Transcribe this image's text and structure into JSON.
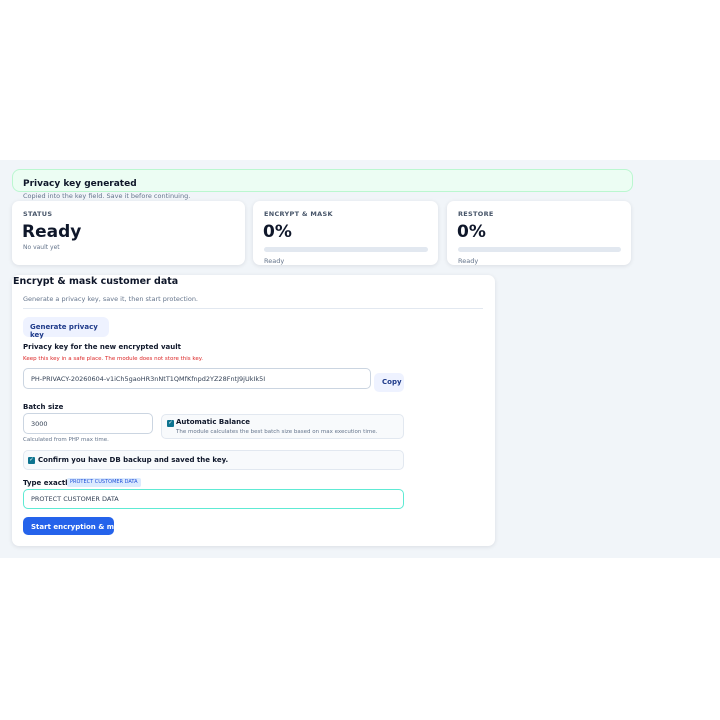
{
  "alert": {
    "title": "Privacy key generated",
    "subtitle": "Copied into the key field. Save it before continuing."
  },
  "stats": {
    "status": {
      "label": "STATUS",
      "value": "Ready",
      "note": "No vault yet"
    },
    "encrypt": {
      "label": "ENCRYPT & MASK",
      "value": "0%",
      "progress": 0,
      "note": "Ready"
    },
    "restore": {
      "label": "RESTORE",
      "value": "0%",
      "progress": 0,
      "note": "Ready"
    }
  },
  "panel": {
    "title": "Encrypt & mask customer data",
    "description": "Generate a privacy key, save it, then start protection.",
    "generate_button": "Generate privacy key",
    "key_label": "Privacy key for the new encrypted vault",
    "key_warning": "Keep this key in a safe place. The module does not store this key.",
    "key_value": "PH-PRIVACY-20260604-v1iCh5gaoHR3nNtT1QMfKfnpd2YZ28FntJ9jUkIk5I",
    "copy_button": "Copy",
    "batch_label": "Batch size",
    "batch_value": "3000",
    "batch_hint": "Calculated from PHP max time.",
    "auto_balance_label": "Automatic Balance",
    "auto_balance_checked": true,
    "auto_balance_hint": "The module calculates the best batch size based on max execution time.",
    "confirm_label": "Confirm you have DB backup and saved the key.",
    "confirm_checked": true,
    "type_label": "Type exactly",
    "type_phrase": "PROTECT CUSTOMER DATA",
    "type_value": "PROTECT CUSTOMER DATA",
    "start_button": "Start encryption & mask"
  },
  "colors": {
    "accent": "#2563eb",
    "success_bg": "#ecfdf3",
    "warning_text": "#dc2626",
    "focus_border": "#5eead4",
    "checkbox": "#0e7490"
  },
  "icons": {
    "checkbox": "check-icon"
  }
}
